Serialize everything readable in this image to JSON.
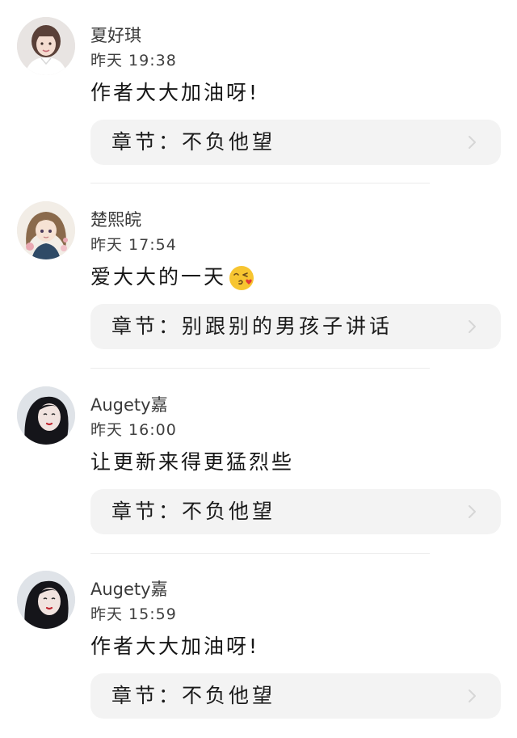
{
  "comments": [
    {
      "username": "夏好琪",
      "time": "昨天 19:38",
      "text": "作者大大加油呀!",
      "chapter_label": "章节：不负他望",
      "avatar_icon": "avatar-girl-white-shirt"
    },
    {
      "username": "楚熙皖",
      "time": "昨天 17:54",
      "text": "爱大大的一天",
      "emoji": "kissing-face-emoji",
      "chapter_label": "章节：别跟别的男孩子讲话",
      "avatar_icon": "avatar-anime-girl"
    },
    {
      "username": "Augety嘉",
      "time": "昨天 16:00",
      "text": "让更新来得更猛烈些",
      "chapter_label": "章节：不负他望",
      "avatar_icon": "avatar-girl-dark-hair"
    },
    {
      "username": "Augety嘉",
      "time": "昨天 15:59",
      "text": "作者大大加油呀!",
      "chapter_label": "章节：不负他望",
      "avatar_icon": "avatar-girl-dark-hair"
    }
  ],
  "icons": {
    "chevron": "chevron-right-icon"
  },
  "colors": {
    "card_background": "#f3f3f3",
    "divider": "#ebebeb",
    "chevron": "#d6d6d6"
  }
}
